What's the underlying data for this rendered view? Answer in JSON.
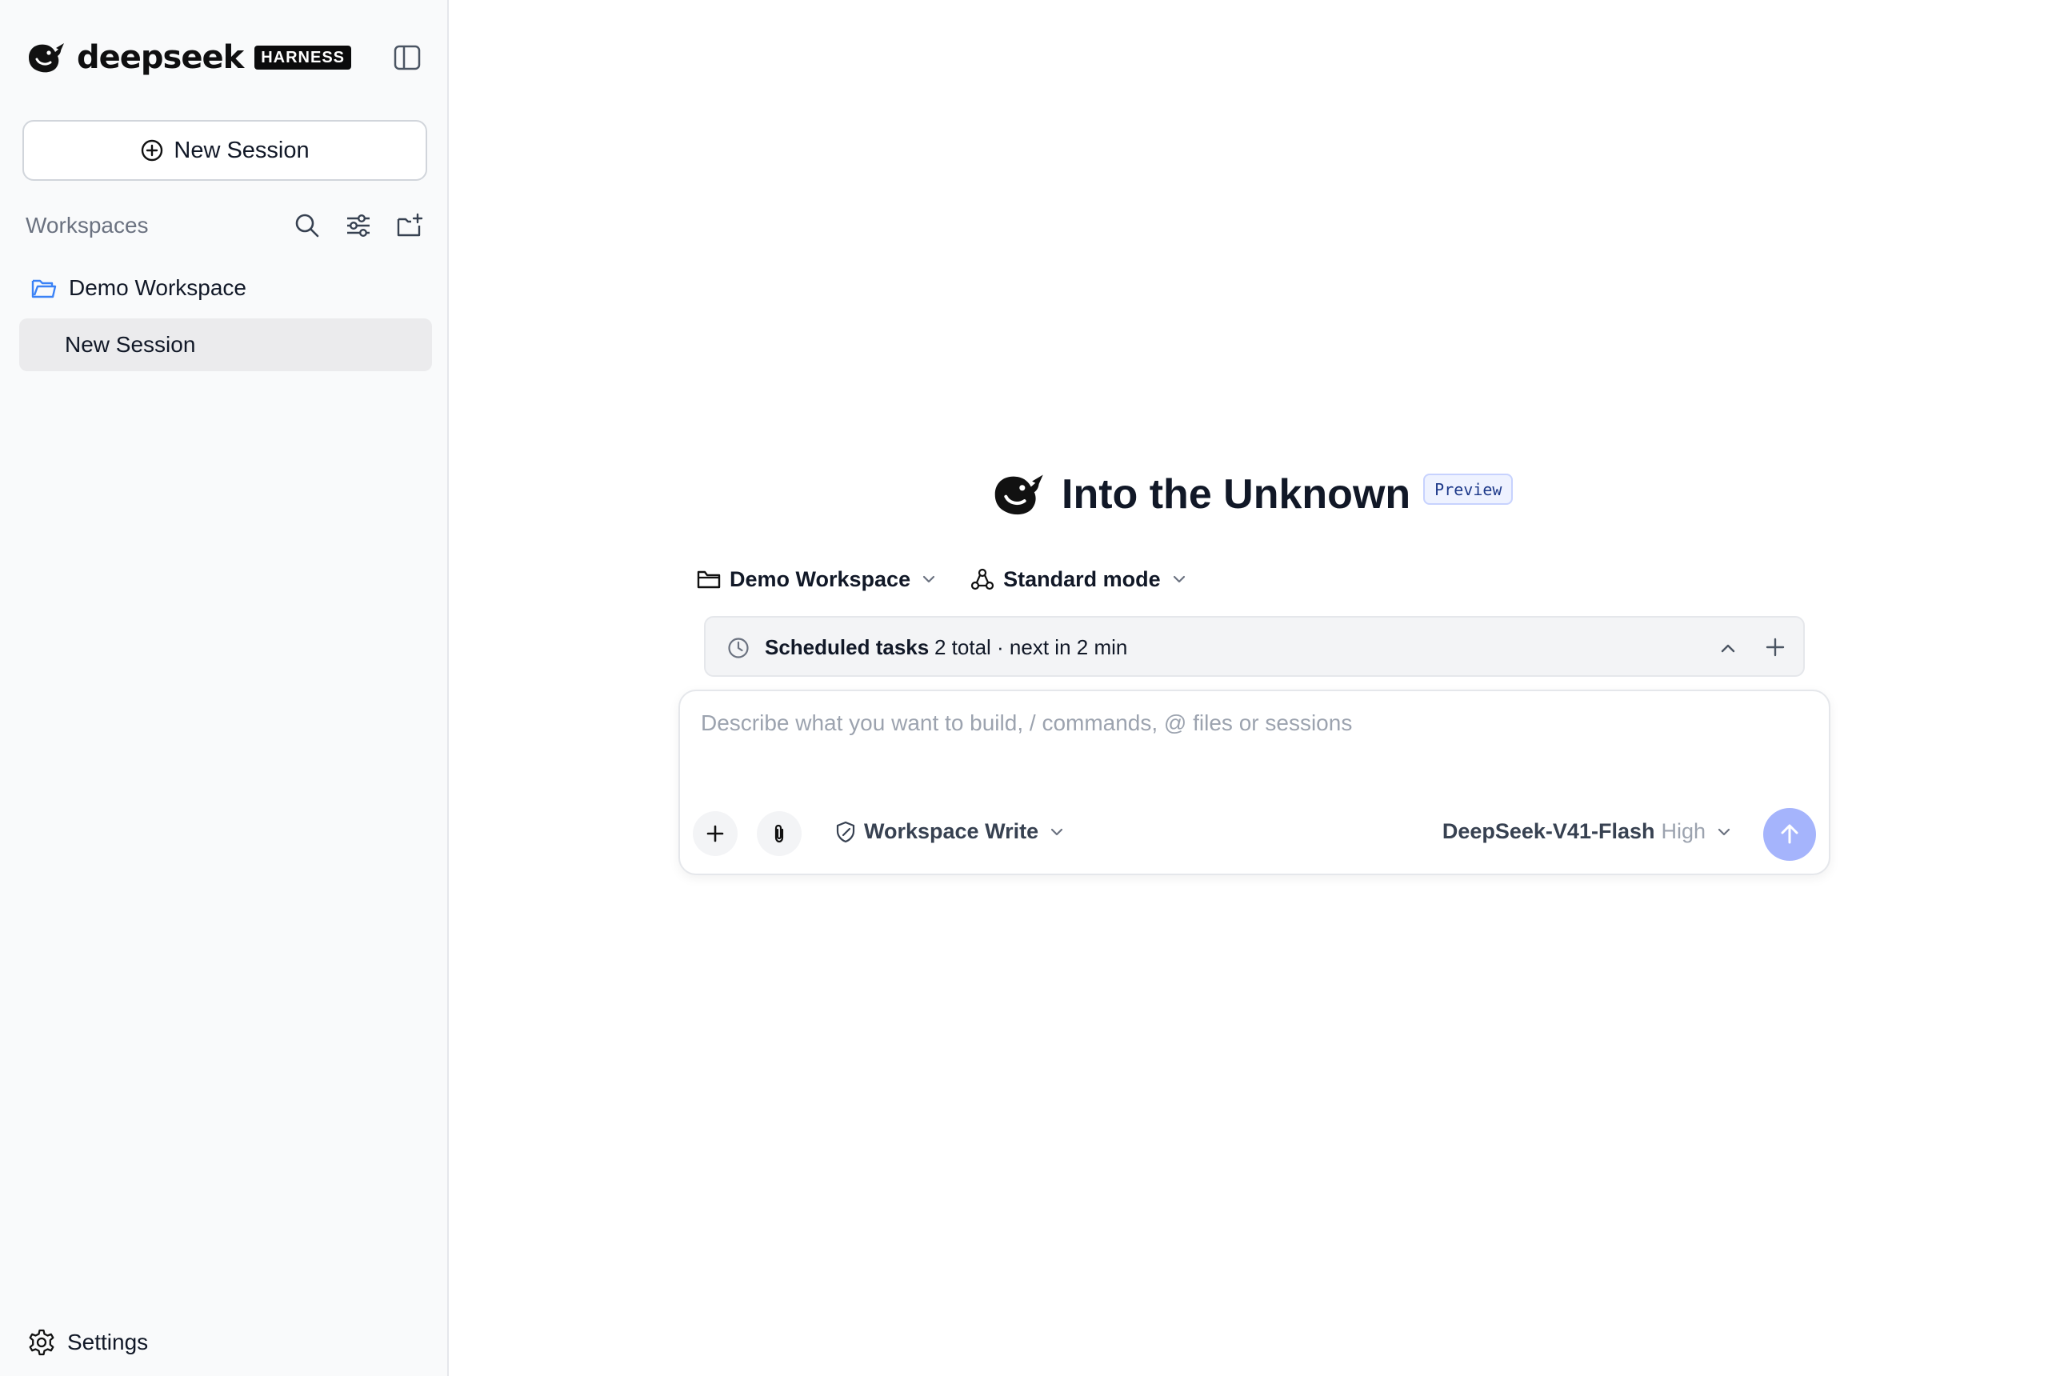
{
  "sidebar": {
    "brand": {
      "name": "deepseek",
      "badge": "HARNESS",
      "logo_icon": "deepseek-whale-icon"
    },
    "toggle_icon": "sidebar-toggle-icon",
    "new_session": {
      "label": "New Session",
      "icon": "plus-circle-icon"
    },
    "workspaces": {
      "label": "Workspaces",
      "tools": [
        "search-icon",
        "filter-sliders-icon",
        "new-folder-icon"
      ],
      "items": [
        {
          "label": "Demo Workspace",
          "icon": "folder-open-icon",
          "sessions": [
            {
              "label": "New Session",
              "selected": true
            }
          ]
        }
      ]
    },
    "settings": {
      "label": "Settings",
      "icon": "gear-icon"
    }
  },
  "main": {
    "hero": {
      "title": "Into the Unknown",
      "badge": "Preview"
    },
    "selectors": {
      "workspace": {
        "label": "Demo Workspace",
        "icon": "folder-icon"
      },
      "mode": {
        "label": "Standard mode",
        "icon": "mode-nodes-icon"
      }
    },
    "scheduled": {
      "title": "Scheduled tasks",
      "meta": "2 total · next in 2 min"
    },
    "composer": {
      "placeholder": "Describe what you want to build, / commands, @ files or sessions",
      "value": "",
      "permission": {
        "label": "Workspace Write",
        "icon": "shield-edit-icon"
      },
      "model": {
        "name": "DeepSeek-V41-Flash",
        "effort": "High"
      },
      "send_icon": "arrow-up-icon"
    }
  },
  "colors": {
    "accent": "#a5b4fc",
    "sidebar_bg": "#f9fafb",
    "selected_bg": "#ebebed",
    "folder_blue": "#3b82f6"
  }
}
